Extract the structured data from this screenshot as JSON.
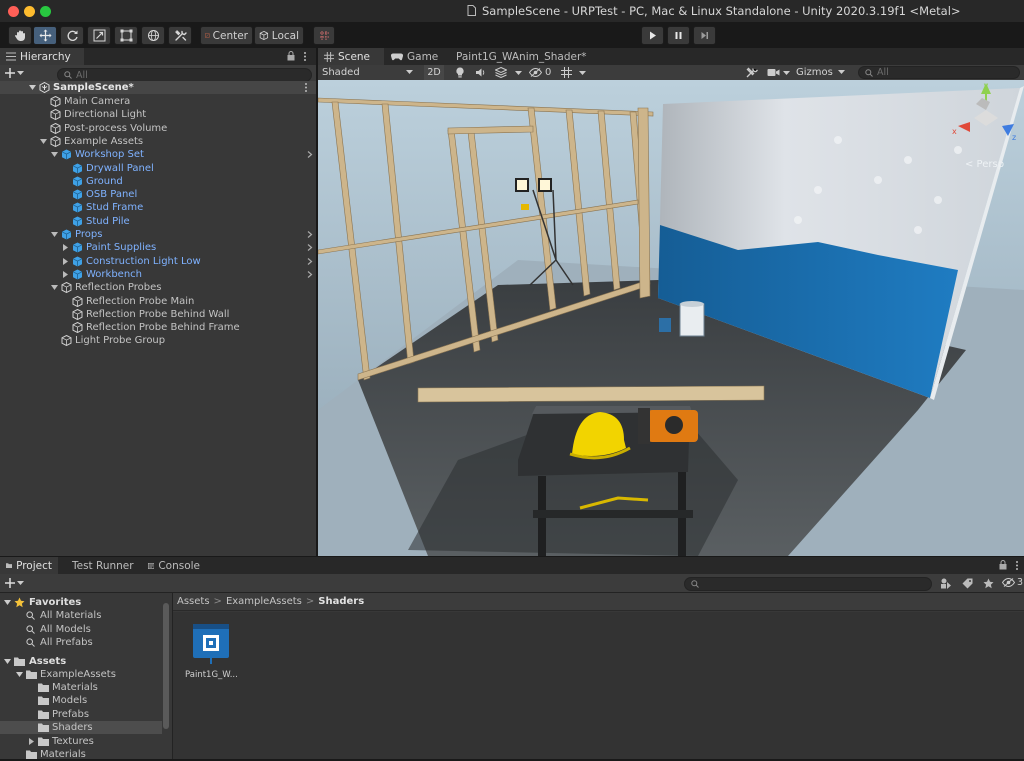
{
  "window": {
    "title": "SampleScene - URPTest - PC, Mac & Linux Standalone - Unity 2020.3.19f1 <Metal>",
    "traffic_lights": {
      "close": "#ff5f57",
      "minimize": "#febc2e",
      "zoom": "#28c840"
    }
  },
  "toolbar": {
    "tools": [
      "hand-icon",
      "move-icon",
      "rotate-icon",
      "scale-icon",
      "rect-icon",
      "transform-icon",
      "custom-tool-icon"
    ],
    "pivot_label": "Center",
    "space_label": "Local",
    "play_controls": [
      "play-icon",
      "pause-icon",
      "step-icon"
    ]
  },
  "hierarchy": {
    "tab": "Hierarchy",
    "search_placeholder": "All",
    "scene_name": "SampleScene*",
    "items": [
      {
        "label": "Main Camera",
        "depth": 1,
        "blue": false
      },
      {
        "label": "Directional Light",
        "depth": 1,
        "blue": false
      },
      {
        "label": "Post-process Volume",
        "depth": 1,
        "blue": false
      },
      {
        "label": "Example Assets",
        "depth": 1,
        "blue": false,
        "expanded": true
      },
      {
        "label": "Workshop Set",
        "depth": 2,
        "blue": true,
        "expanded": true,
        "more": true
      },
      {
        "label": "Drywall Panel",
        "depth": 3,
        "blue": true
      },
      {
        "label": "Ground",
        "depth": 3,
        "blue": true
      },
      {
        "label": "OSB Panel",
        "depth": 3,
        "blue": true
      },
      {
        "label": "Stud Frame",
        "depth": 3,
        "blue": true
      },
      {
        "label": "Stud Pile",
        "depth": 3,
        "blue": true
      },
      {
        "label": "Props",
        "depth": 2,
        "blue": true,
        "expanded": true,
        "more": true
      },
      {
        "label": "Paint Supplies",
        "depth": 3,
        "blue": true,
        "collapsed": true,
        "more": true
      },
      {
        "label": "Construction Light Low",
        "depth": 3,
        "blue": true,
        "collapsed": true,
        "more": true
      },
      {
        "label": "Workbench",
        "depth": 3,
        "blue": true,
        "collapsed": true,
        "more": true
      },
      {
        "label": "Reflection Probes",
        "depth": 2,
        "blue": false,
        "expanded": true
      },
      {
        "label": "Reflection Probe Main",
        "depth": 3,
        "blue": false
      },
      {
        "label": "Reflection Probe Behind Wall",
        "depth": 3,
        "blue": false
      },
      {
        "label": "Reflection Probe Behind Frame",
        "depth": 3,
        "blue": false
      },
      {
        "label": "Light Probe Group",
        "depth": 2,
        "blue": false
      }
    ]
  },
  "scene_tabs": [
    {
      "label": "Scene",
      "active": true
    },
    {
      "label": "Game",
      "active": false
    },
    {
      "label": "Paint1G_WAnim_Shader*",
      "active": false
    }
  ],
  "scene_toolbar": {
    "draw_mode": "Shaded",
    "mode_2d": "2D",
    "hidden_count": "0",
    "gizmos_label": "Gizmos",
    "search_placeholder": "All"
  },
  "scene_view": {
    "projection_label": "< Persp",
    "gizmo_axes": [
      "x",
      "y",
      "z"
    ],
    "colors": {
      "sky": "#a9bccb",
      "floor": "#4b4f52",
      "wall": "#dfe3e8",
      "paint": "#1d6fb0",
      "wood": "#cdb58b"
    }
  },
  "project": {
    "tabs": [
      {
        "label": "Project",
        "active": true
      },
      {
        "label": "Test Runner",
        "active": false
      },
      {
        "label": "Console",
        "active": false
      }
    ],
    "hidden_count": "3",
    "favorites_label": "Favorites",
    "favorites": [
      "All Materials",
      "All Models",
      "All Prefabs"
    ],
    "assets_label": "Assets",
    "example_assets_label": "ExampleAssets",
    "folders": [
      "Materials",
      "Models",
      "Prefabs",
      "Shaders",
      "Textures"
    ],
    "materials_label": "Materials",
    "breadcrumb": [
      "Assets",
      "ExampleAssets",
      "Shaders"
    ],
    "asset": {
      "name": "Paint1G_W..."
    }
  }
}
